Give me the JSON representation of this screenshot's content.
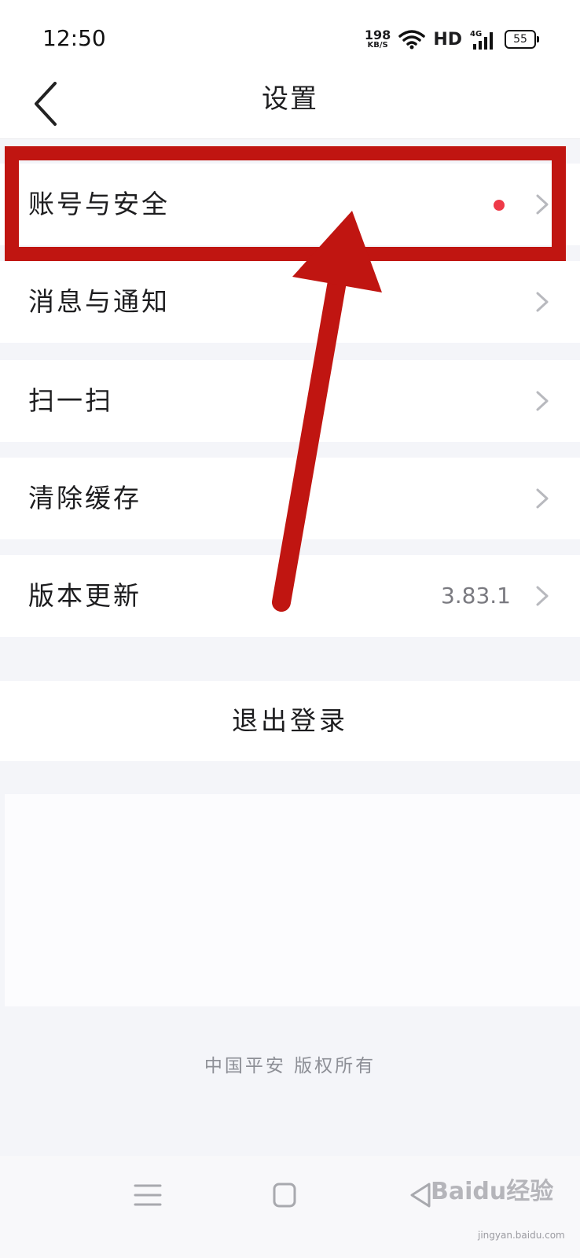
{
  "status_bar": {
    "time": "12:50",
    "net_speed_value": "198",
    "net_speed_unit": "KB/S",
    "hd_label": "HD",
    "signal_label": "4G",
    "battery_level": "55"
  },
  "header": {
    "title": "设置"
  },
  "settings_items": [
    {
      "label": "账号与安全",
      "has_dot": true
    },
    {
      "label": "消息与通知"
    },
    {
      "label": "扫一扫"
    },
    {
      "label": "清除缓存"
    },
    {
      "label": "版本更新",
      "value": "3.83.1"
    }
  ],
  "logout": {
    "label": "退出登录"
  },
  "footer": {
    "copyright": "中国平安 版权所有"
  },
  "watermark": {
    "text": "Baidu经验",
    "url": "jingyan.baidu.com"
  },
  "colors": {
    "annotation_red": "#c01511",
    "dot_red": "#ee3a48",
    "background": "#f4f5f9"
  }
}
